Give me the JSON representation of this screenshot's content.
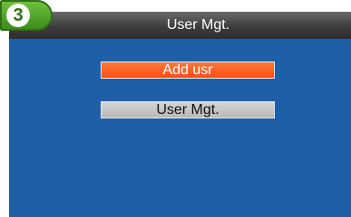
{
  "step_badge": {
    "number": "3"
  },
  "titlebar": {
    "title": "User Mgt."
  },
  "menu": {
    "items": [
      {
        "label": "Add usr",
        "selected": true
      },
      {
        "label": "User Mgt.",
        "selected": false
      }
    ]
  },
  "colors": {
    "panel_background": "#1f5fa8",
    "selected_item": "#ff5a1f",
    "normal_item": "#c8c8c8",
    "badge_green": "#4fa52a"
  }
}
